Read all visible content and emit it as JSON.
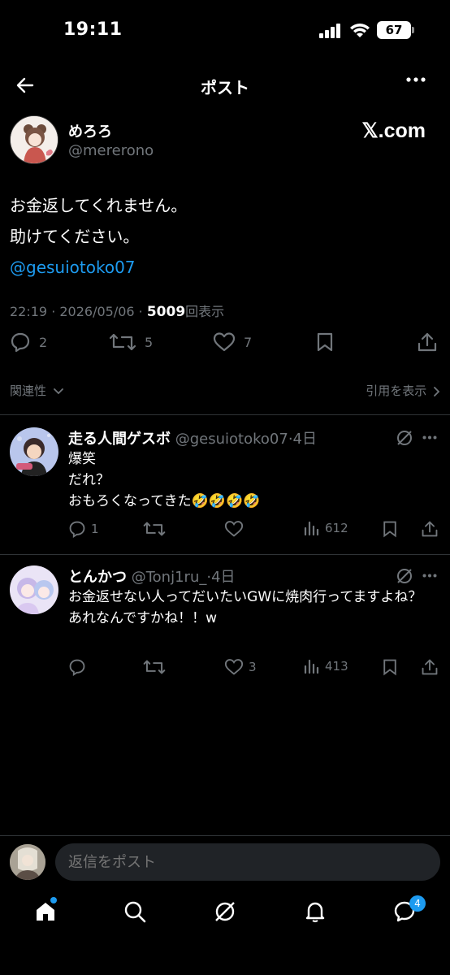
{
  "status_bar": {
    "time": "19:11",
    "battery": "67"
  },
  "header": {
    "title": "ポスト"
  },
  "post": {
    "author_name": "めろろ",
    "author_handle": "@mererono",
    "source_logo": "𝕏.com",
    "lines": [
      "お金返してくれません。",
      "助けてください。"
    ],
    "mention": "@gesuiotoko07",
    "timestamp": "22:19 · 2026/05/06 · ",
    "views": "5009",
    "views_label": "回表示",
    "reply_count": "2",
    "repost_count": "5",
    "like_count": "7"
  },
  "sort": {
    "left_label": "関連性",
    "right_label": "引用を表示"
  },
  "replies": [
    {
      "name": "走る人間ゲスボ",
      "handle": "@gesuiotoko07",
      "time": "·4日",
      "lines": [
        "爆笑",
        "だれ？",
        "おもろくなってきた🤣🤣🤣🤣"
      ],
      "reply_count": "1",
      "like_count": "",
      "views": "612"
    },
    {
      "name": "とんかつ",
      "handle": "@Tonj1ru_",
      "time": "·4日",
      "lines": [
        "お金返せない人ってだいたいGWに焼肉行ってますよね？",
        "あれなんですかね！！w"
      ],
      "reply_count": "",
      "like_count": "3",
      "views": "413"
    }
  ],
  "compose": {
    "placeholder": "返信をポスト"
  },
  "tabbar": {
    "messages_badge": "4"
  },
  "colors": {
    "background": "#000000",
    "accent": "#1d9bf0",
    "muted": "#71767b",
    "divider": "#2f3336"
  }
}
